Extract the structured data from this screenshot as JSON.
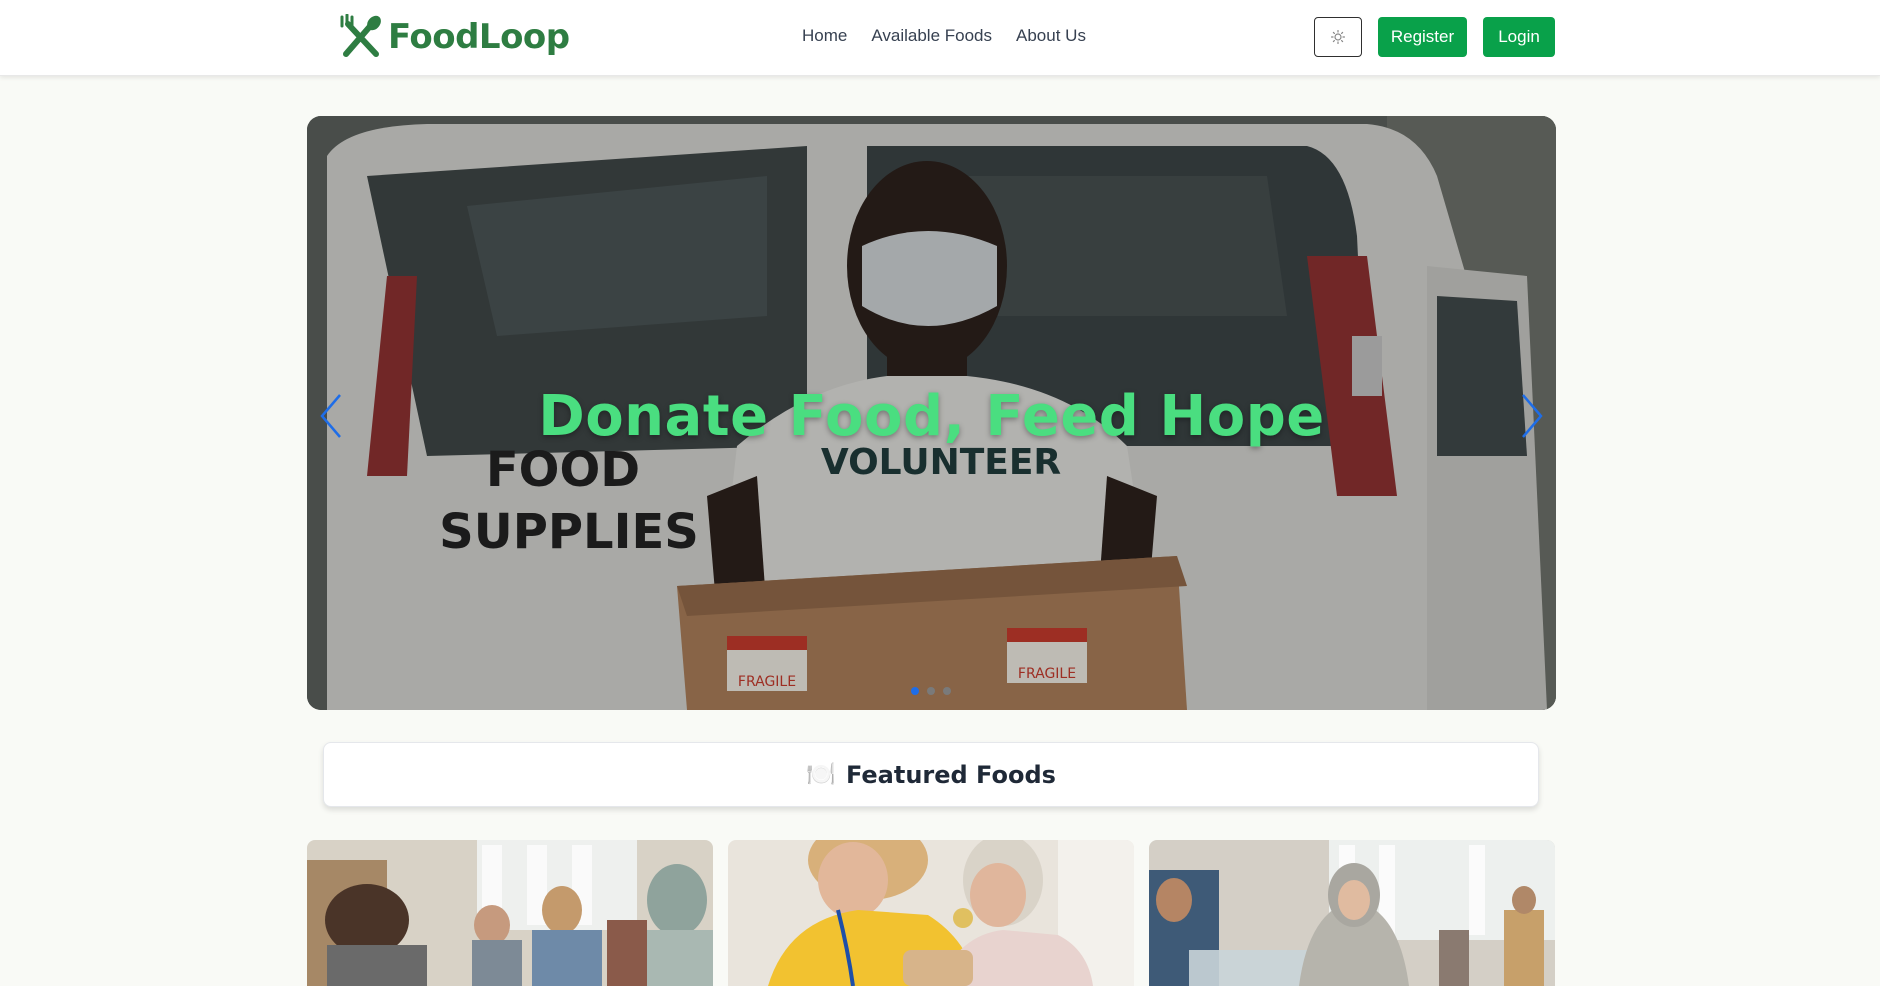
{
  "navbar": {
    "logo_text": "FoodLoop",
    "links": [
      "Home",
      "Available Foods",
      "About Us"
    ],
    "theme_toggle_icon": "sun-icon",
    "register_label": "Register",
    "login_label": "Login"
  },
  "hero": {
    "title": "Donate Food, Feed Hope",
    "van_text_line1": "FOOD",
    "van_text_line2": "SUPPLIES",
    "shirt_text": "VOLUNTEER",
    "box_label": "FRAGILE",
    "slide_count": 3,
    "active_slide": 1
  },
  "featured": {
    "icon": "🍽️",
    "title": "Featured Foods"
  },
  "colors": {
    "brand_green": "#2e7d42",
    "button_green": "#09a14a",
    "hero_title_green": "#4ade80",
    "accent_blue": "#1e6de8",
    "page_bg": "#f9faf6"
  }
}
